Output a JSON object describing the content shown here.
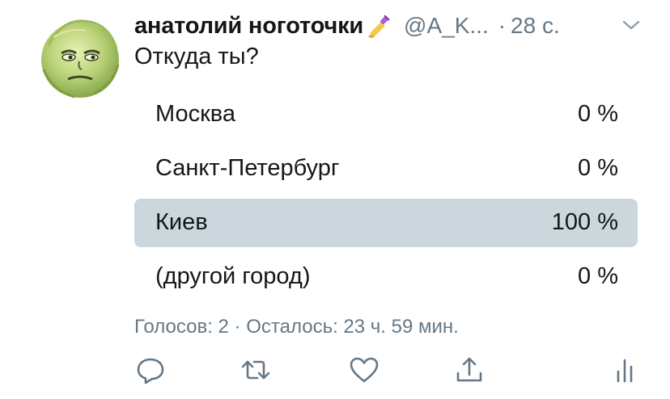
{
  "tweet": {
    "display_name": "анатолий ноготочки",
    "handle": "@A_K...",
    "separator": "·",
    "time": "28 с.",
    "text": "Откуда ты?"
  },
  "poll": {
    "options": [
      {
        "label": "Москва",
        "percent_text": "0 %",
        "percent": 0,
        "leading": false
      },
      {
        "label": "Санкт-Петербург",
        "percent_text": "0 %",
        "percent": 0,
        "leading": false
      },
      {
        "label": "Киев",
        "percent_text": "100 %",
        "percent": 100,
        "leading": true
      },
      {
        "label": "(другой город)",
        "percent_text": "0 %",
        "percent": 0,
        "leading": false
      }
    ],
    "meta": "Голосов: 2 · Осталось: 23 ч. 59 мин."
  },
  "icons": {
    "avatar": "cabbage-face-avatar",
    "name_emoji": "nail-polish-emoji",
    "menu": "chevron-down-icon",
    "reply": "reply-icon",
    "retweet": "retweet-icon",
    "like": "heart-icon",
    "share": "share-icon",
    "analytics": "analytics-icon"
  },
  "colors": {
    "text": "#14171a",
    "secondary": "#657786",
    "poll_bar": "#ccd6dd"
  }
}
